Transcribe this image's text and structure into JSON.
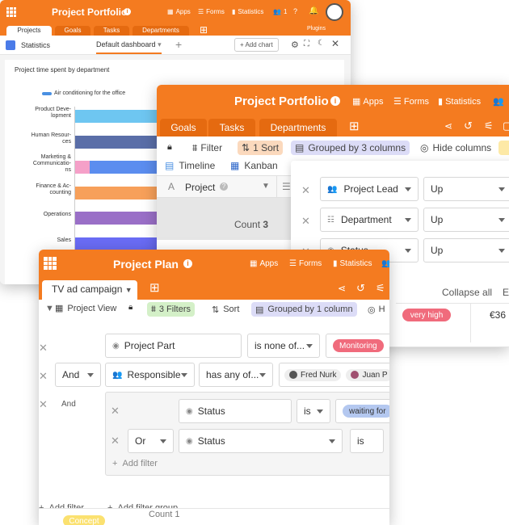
{
  "win1": {
    "title": "Project Portfolio",
    "nav": [
      "Apps",
      "Forms",
      "Statistics",
      "1"
    ],
    "tabs": [
      "Projects",
      "Goals",
      "Tasks",
      "Departments"
    ],
    "right_label": "Plugins",
    "stats_label": "Statistics",
    "dashboard": "Default dashboard",
    "add_chart": "Add chart",
    "chart_data": {
      "type": "bar",
      "title": "Project time spent by department",
      "legend": [
        "Air conditioning for the office"
      ],
      "categories": [
        "Product Deve-\nlopment",
        "Human Resour-\nces",
        "Marketing &\nCommunicatio-\nns",
        "Finance & Ac-\ncounting",
        "Operations",
        "Sales"
      ],
      "colors": [
        "#6ec6f1",
        "#5a6ea8",
        "#5b8def",
        "#f7a05a",
        "#9a6fc7",
        "#6a6cf5"
      ],
      "segments": [
        [
          0,
          0
        ],
        [
          0,
          0
        ],
        [
          0.12,
          0
        ],
        [
          0,
          0
        ],
        [
          0,
          0
        ],
        [
          0,
          0
        ]
      ]
    }
  },
  "win2": {
    "title": "Project Portfolio",
    "nav": [
      "Apps",
      "Forms",
      "Statistics"
    ],
    "tabs": [
      "Goals",
      "Tasks",
      "Departments"
    ],
    "toolbar": {
      "filter": "Filter",
      "sort": "1 Sort",
      "grouped": "Grouped by 3 columns",
      "hide": "Hide columns"
    },
    "views": [
      "Timeline",
      "Kanban"
    ],
    "col_project": "Project",
    "count_label": "Count",
    "count_value": "3",
    "group_rows": [
      {
        "field": "Project Lead",
        "dir": "Up"
      },
      {
        "field": "Department",
        "dir": "Up"
      },
      {
        "field": "Status",
        "dir": "Up"
      }
    ],
    "collapse_all": "Collapse all",
    "expand_partial": "E",
    "priority_pill": "very high",
    "amount": "€36"
  },
  "win3": {
    "title": "Project Plan",
    "nav": [
      "Apps",
      "Forms",
      "Statistics"
    ],
    "tab": "TV ad campaign",
    "toolbar": {
      "view": "Project View",
      "filters": "3 Filters",
      "sort": "Sort",
      "grouped": "Grouped by 1 column",
      "h": "H"
    },
    "filter_rows": {
      "row1": {
        "field": "Project Part",
        "op": "is none of...",
        "value": "Monitoring"
      },
      "row2": {
        "conj": "And",
        "field": "Responsible",
        "op": "has any of...",
        "values": [
          "Fred Nurk",
          "Juan P"
        ]
      },
      "row3": {
        "conj": "And"
      },
      "nested1": {
        "field": "Status",
        "op": "is",
        "value": "waiting for"
      },
      "nested2": {
        "conj": "Or",
        "field": "Status",
        "op": "is"
      },
      "add_filter_inner": "Add filter"
    },
    "add_filter": "Add filter",
    "add_filter_group": "Add filter group",
    "bottom_pill": "Concept",
    "bottom_count": "Count 1"
  },
  "colors": {
    "accent": "#f47b20",
    "dark_tab": "#e56a10"
  }
}
